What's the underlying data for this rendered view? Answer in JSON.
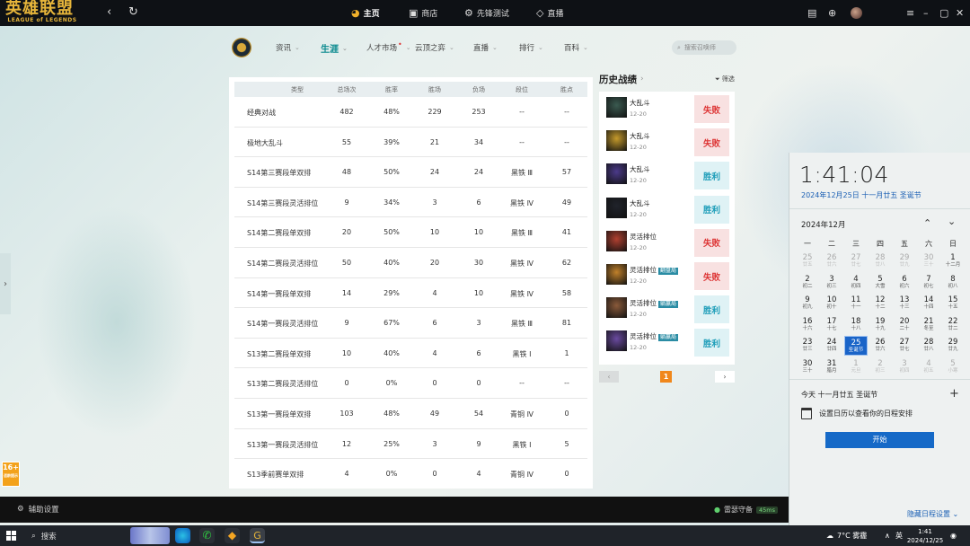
{
  "app": {
    "logo_main": "英雄联盟",
    "logo_sub": "LEAGUE of LEGENDS"
  },
  "topnav": {
    "items": [
      {
        "label": "主页",
        "icon": "home-icon"
      },
      {
        "label": "商店",
        "icon": "store-icon"
      },
      {
        "label": "先锋测试",
        "icon": "test-icon"
      },
      {
        "label": "直播",
        "icon": "live-icon"
      }
    ]
  },
  "subnav": {
    "items": [
      "资讯",
      "生涯",
      "人才市场",
      "云顶之弈",
      "直播",
      "排行",
      "百科"
    ],
    "search_placeholder": "搜索召唤师"
  },
  "stats_table": {
    "headers": [
      "类型",
      "总场次",
      "胜率",
      "胜场",
      "负场",
      "段位",
      "胜点"
    ],
    "rows": [
      [
        "经典对战",
        "482",
        "48%",
        "229",
        "253",
        "--",
        "--"
      ],
      [
        "极地大乱斗",
        "55",
        "39%",
        "21",
        "34",
        "--",
        "--"
      ],
      [
        "S14第三赛段单双排",
        "48",
        "50%",
        "24",
        "24",
        "黑铁 Ⅲ",
        "57"
      ],
      [
        "S14第三赛段灵活排位",
        "9",
        "34%",
        "3",
        "6",
        "黑铁 Ⅳ",
        "49"
      ],
      [
        "S14第二赛段单双排",
        "20",
        "50%",
        "10",
        "10",
        "黑铁 Ⅲ",
        "41"
      ],
      [
        "S14第二赛段灵活排位",
        "50",
        "40%",
        "20",
        "30",
        "黑铁 Ⅳ",
        "62"
      ],
      [
        "S14第一赛段单双排",
        "14",
        "29%",
        "4",
        "10",
        "黑铁 Ⅳ",
        "58"
      ],
      [
        "S14第一赛段灵活排位",
        "9",
        "67%",
        "6",
        "3",
        "黑铁 Ⅲ",
        "81"
      ],
      [
        "S13第二赛段单双排",
        "10",
        "40%",
        "4",
        "6",
        "黑铁 Ⅰ",
        "1"
      ],
      [
        "S13第二赛段灵活排位",
        "0",
        "0%",
        "0",
        "0",
        "--",
        "--"
      ],
      [
        "S13第一赛段单双排",
        "103",
        "48%",
        "49",
        "54",
        "青铜 Ⅳ",
        "0"
      ],
      [
        "S13第一赛段灵活排位",
        "12",
        "25%",
        "3",
        "9",
        "黑铁 Ⅰ",
        "5"
      ],
      [
        "S13季前赛单双排",
        "4",
        "0%",
        "0",
        "4",
        "青铜 Ⅳ",
        "0"
      ]
    ]
  },
  "history": {
    "title": "历史战绩",
    "filter_label": "筛选",
    "matches": [
      {
        "mode": "大乱斗",
        "tag": "",
        "date": "12-20",
        "result": "失败",
        "win": false,
        "color": "#3a5a50"
      },
      {
        "mode": "大乱斗",
        "tag": "",
        "date": "12-20",
        "result": "失败",
        "win": false,
        "color": "#c59a2b"
      },
      {
        "mode": "大乱斗",
        "tag": "",
        "date": "12-20",
        "result": "胜利",
        "win": true,
        "color": "#4b3a8a"
      },
      {
        "mode": "大乱斗",
        "tag": "",
        "date": "12-20",
        "result": "胜利",
        "win": true,
        "color": "#20232b"
      },
      {
        "mode": "灵活排位",
        "tag": "",
        "date": "12-20",
        "result": "失败",
        "win": false,
        "color": "#b04030"
      },
      {
        "mode": "灵活排位",
        "tag": "翻盘局",
        "date": "12-20",
        "result": "失败",
        "win": false,
        "color": "#c0802a"
      },
      {
        "mode": "灵活排位",
        "tag": "躺赢局",
        "date": "12-20",
        "result": "胜利",
        "win": true,
        "color": "#8a5a3a"
      },
      {
        "mode": "灵活排位",
        "tag": "躺赢局",
        "date": "12-20",
        "result": "胜利",
        "win": true,
        "color": "#6a4aa0"
      }
    ],
    "page": "1"
  },
  "age_badge": {
    "rating": "16+",
    "label": "适龄提示"
  },
  "bottombar": {
    "assist_label": "辅助设置",
    "server": "雷瑟守备",
    "ping": "45ms"
  },
  "calendar": {
    "time": "1:41:04",
    "date_line": "2024年12月25日 十一月廿五 圣诞节",
    "month": "2024年12月",
    "weekdays": [
      "一",
      "二",
      "三",
      "四",
      "五",
      "六",
      "日"
    ],
    "weeks": [
      [
        [
          "25",
          "廿五",
          1
        ],
        [
          "26",
          "廿六",
          1
        ],
        [
          "27",
          "廿七",
          1
        ],
        [
          "28",
          "廿八",
          1
        ],
        [
          "29",
          "廿九",
          1
        ],
        [
          "30",
          "三十",
          1
        ],
        [
          "1",
          "十二月",
          0
        ]
      ],
      [
        [
          "2",
          "初二",
          0
        ],
        [
          "3",
          "初三",
          0
        ],
        [
          "4",
          "初四",
          0
        ],
        [
          "5",
          "大雪",
          0
        ],
        [
          "6",
          "初六",
          0
        ],
        [
          "7",
          "初七",
          0
        ],
        [
          "8",
          "初八",
          0
        ]
      ],
      [
        [
          "9",
          "初九",
          0
        ],
        [
          "10",
          "初十",
          0
        ],
        [
          "11",
          "十一",
          0
        ],
        [
          "12",
          "十二",
          0
        ],
        [
          "13",
          "十三",
          0
        ],
        [
          "14",
          "十四",
          0
        ],
        [
          "15",
          "十五",
          0
        ]
      ],
      [
        [
          "16",
          "十六",
          0
        ],
        [
          "17",
          "十七",
          0
        ],
        [
          "18",
          "十八",
          0
        ],
        [
          "19",
          "十九",
          0
        ],
        [
          "20",
          "二十",
          0
        ],
        [
          "21",
          "冬至",
          0
        ],
        [
          "22",
          "廿二",
          0
        ]
      ],
      [
        [
          "23",
          "廿三",
          0
        ],
        [
          "24",
          "廿四",
          0
        ],
        [
          "25",
          "圣诞节",
          2
        ],
        [
          "26",
          "廿六",
          0
        ],
        [
          "27",
          "廿七",
          0
        ],
        [
          "28",
          "廿八",
          0
        ],
        [
          "29",
          "廿九",
          0
        ]
      ],
      [
        [
          "30",
          "三十",
          0
        ],
        [
          "31",
          "腊月",
          0
        ],
        [
          "1",
          "元旦",
          1
        ],
        [
          "2",
          "初三",
          1
        ],
        [
          "3",
          "初四",
          1
        ],
        [
          "4",
          "初五",
          1
        ],
        [
          "5",
          "小寒",
          1
        ]
      ]
    ],
    "today_line": "今天 十一月廿五 圣诞节",
    "schedule_hint": "设置日历以查看你的日程安排",
    "start_button": "开始",
    "hide_schedule": "隐藏日程设置"
  },
  "taskbar": {
    "search_label": "搜索",
    "weather": "7°C 雾霾",
    "ime": "英",
    "time": "1:41",
    "date": "2024/12/25"
  }
}
